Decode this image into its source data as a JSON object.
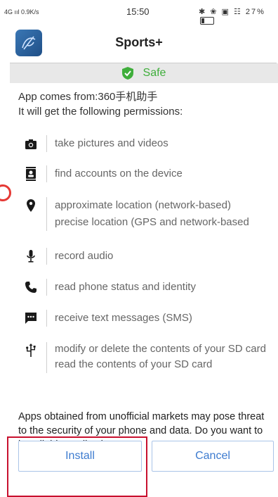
{
  "status_bar": {
    "network": "4G ııl 0.9K/s",
    "time": "15:50",
    "indicators": "✱ ❀ ▣ ☷ 27%"
  },
  "header": {
    "app_name": "Sports+"
  },
  "safe_banner": {
    "label": "Safe",
    "color": "#3fae3b"
  },
  "source_text": "App comes from:360手机助手",
  "permissions_intro": "It will get the following permissions:",
  "permissions": [
    {
      "icon": "camera-icon",
      "lines": [
        "take pictures and videos"
      ]
    },
    {
      "icon": "contacts-icon",
      "lines": [
        "find accounts on the device"
      ]
    },
    {
      "icon": "location-pin-icon",
      "lines": [
        "approximate location (network-based)",
        "precise location (GPS and network-based"
      ]
    },
    {
      "icon": "microphone-icon",
      "lines": [
        "record audio"
      ]
    },
    {
      "icon": "phone-icon",
      "lines": [
        "read phone status and identity"
      ]
    },
    {
      "icon": "message-icon",
      "lines": [
        "receive text messages (SMS)"
      ]
    },
    {
      "icon": "usb-icon",
      "lines": [
        "modify or delete the contents of your SD card",
        "read the contents of your SD card"
      ]
    }
  ],
  "warning_text": "Apps obtained from unofficial markets may pose threat to the security of your phone and data. Do you want to install this application?",
  "buttons": {
    "install": "Install",
    "cancel": "Cancel"
  },
  "colors": {
    "accent": "#3d7bcf",
    "highlight": "#c8102e"
  }
}
